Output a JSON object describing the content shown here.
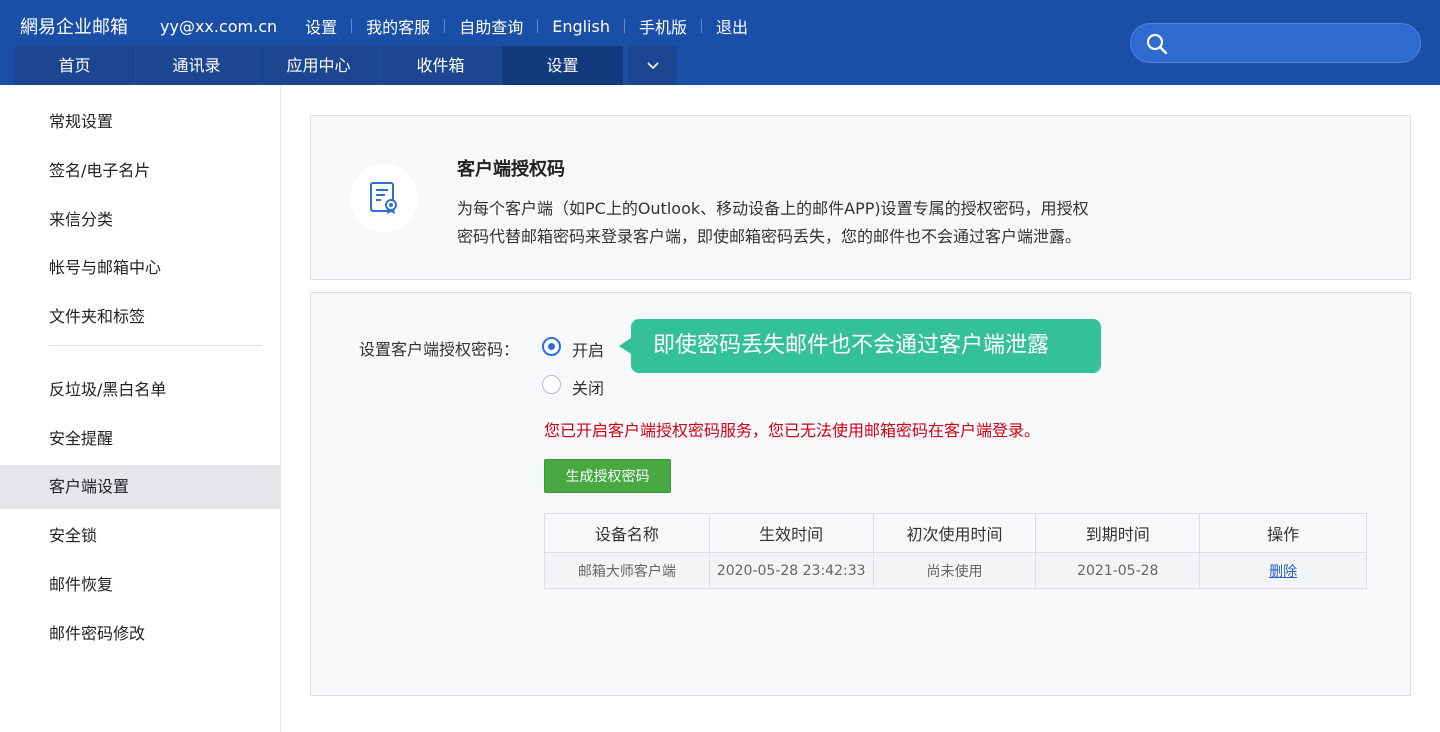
{
  "header": {
    "brand": "網易企业邮箱",
    "email": "yy@xx.com.cn",
    "links": [
      "设置",
      "我的客服",
      "自助查询",
      "English",
      "手机版",
      "退出"
    ],
    "tabs": [
      "首页",
      "通讯录",
      "应用中心",
      "收件箱",
      "设置"
    ],
    "active_tab": "设置"
  },
  "sidebar": {
    "items": [
      "常规设置",
      "签名/电子名片",
      "来信分类",
      "帐号与邮箱中心",
      "文件夹和标签",
      "反垃圾/黑白名单",
      "安全提醒",
      "客户端设置",
      "安全锁",
      "邮件恢复",
      "邮件密码修改"
    ],
    "active": "客户端设置"
  },
  "intro": {
    "title": "客户端授权码",
    "desc_line1": "为每个客户端（如PC上的Outlook、移动设备上的邮件APP)设置专属的授权密码，用授权",
    "desc_line2": "密码代替邮箱密码来登录客户端，即使邮箱密码丢失，您的邮件也不会通过客户端泄露。"
  },
  "auth": {
    "label": "设置客户端授权密码：",
    "option_on": "开启",
    "option_off": "关闭",
    "selected": "开启",
    "tooltip": "即使密码丢失邮件也不会通过客户端泄露",
    "warning": "您已开启客户端授权密码服务，您已无法使用邮箱密码在客户端登录。",
    "generate_button": "生成授权密码"
  },
  "devices": {
    "headers": [
      "设备名称",
      "生效时间",
      "初次使用时间",
      "到期时间",
      "操作"
    ],
    "rows": [
      {
        "name": "邮箱大师客户端",
        "effective": "2020-05-28 23:42:33",
        "first_use": "尚未使用",
        "expiry": "2021-05-28",
        "action": "删除"
      }
    ]
  },
  "colors": {
    "header_bg": "#1a4fa8",
    "tooltip_bg": "#35c196",
    "warning": "#d0021b",
    "button_bg": "#48a842",
    "radio_accent": "#2b6fd8"
  }
}
